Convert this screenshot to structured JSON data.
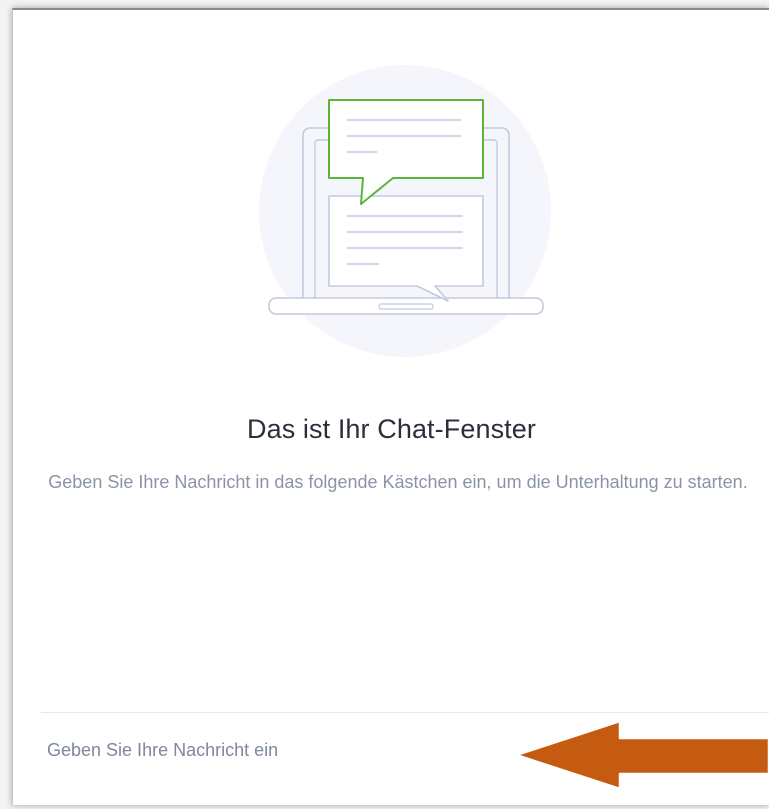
{
  "chat": {
    "empty_title": "Das ist Ihr Chat-Fenster",
    "empty_subtitle": "Geben Sie Ihre Nachricht in das folgende Kästchen ein, um die Unterhaltung zu starten.",
    "input_placeholder": "Geben Sie Ihre Nachricht ein",
    "input_value": ""
  },
  "icons": {
    "illustration": "laptop-chat-illustration",
    "send": "send-icon",
    "annotation": "arrow-annotation"
  },
  "colors": {
    "accent_green": "#5cb53b",
    "illustration_line": "#c3c9de",
    "illustration_bg": "#f4f6fb",
    "title_text": "#2b2f3a",
    "subtitle_text": "#8b93a7",
    "annotation_arrow": "#c55a11"
  }
}
